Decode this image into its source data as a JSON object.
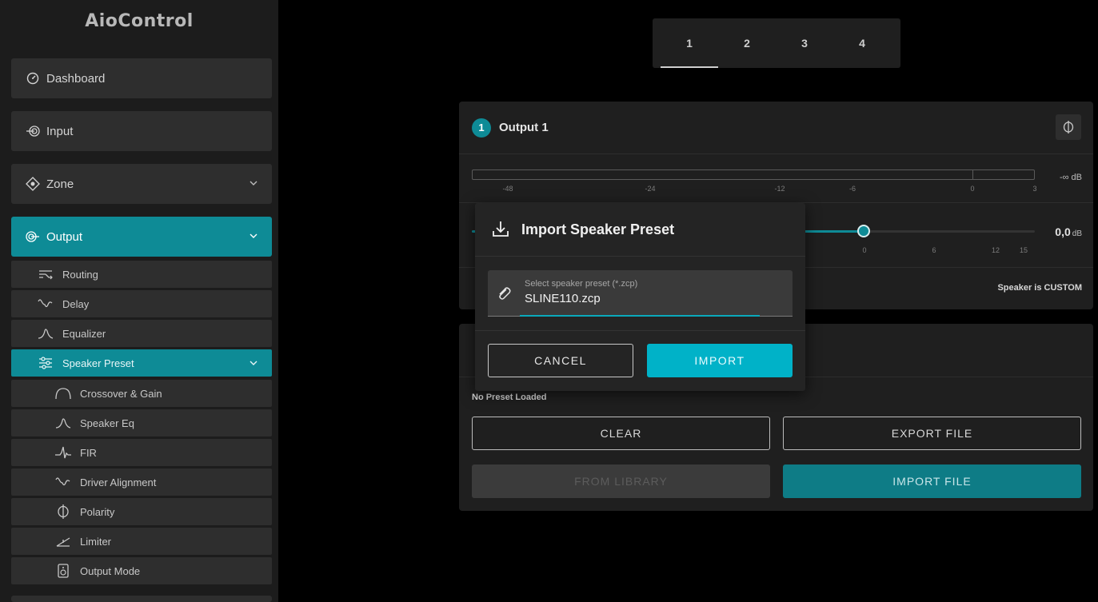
{
  "app": {
    "title": "AioControl"
  },
  "sidebar": {
    "main": [
      {
        "id": "dashboard",
        "label": "Dashboard",
        "icon": "gauge-icon"
      },
      {
        "id": "input",
        "label": "Input",
        "icon": "input-icon"
      },
      {
        "id": "zone",
        "label": "Zone",
        "icon": "zone-icon"
      },
      {
        "id": "output",
        "label": "Output",
        "icon": "output-icon"
      }
    ],
    "output_sub": [
      {
        "label": "Routing",
        "icon": "routing-icon"
      },
      {
        "label": "Delay",
        "icon": "delay-icon"
      },
      {
        "label": "Equalizer",
        "icon": "equalizer-icon"
      },
      {
        "label": "Speaker Preset",
        "icon": "sliders-icon"
      }
    ],
    "preset_sub": [
      {
        "label": "Crossover & Gain",
        "icon": "crossover-icon"
      },
      {
        "label": "Speaker Eq",
        "icon": "speaker-eq-icon"
      },
      {
        "label": "FIR",
        "icon": "fir-icon"
      },
      {
        "label": "Driver Alignment",
        "icon": "alignment-icon"
      },
      {
        "label": "Polarity",
        "icon": "polarity-icon"
      },
      {
        "label": "Limiter",
        "icon": "limiter-icon"
      },
      {
        "label": "Output Mode",
        "icon": "output-mode-icon"
      }
    ]
  },
  "tabs": [
    "1",
    "2",
    "3",
    "4"
  ],
  "active_tab": "1",
  "output_card": {
    "badge": "1",
    "title": "Output 1",
    "meter": {
      "labels": [
        "-48",
        "-24",
        "-12",
        "-6",
        "0",
        "3"
      ],
      "readout": "-∞ dB"
    },
    "fader": {
      "labels": [
        "0",
        "6",
        "12",
        "15"
      ],
      "value": "0,0",
      "unit": "dB"
    },
    "speaker_status": "Speaker is CUSTOM"
  },
  "preset_card": {
    "status": "No Preset Loaded",
    "buttons": {
      "clear": "CLEAR",
      "export": "EXPORT FILE",
      "library": "FROM LIBRARY",
      "import": "IMPORT FILE"
    }
  },
  "modal": {
    "title": "Import Speaker Preset",
    "field_label": "Select speaker preset (*.zcp)",
    "field_value": "SLINE110.zcp",
    "cancel": "CANCEL",
    "import": "IMPORT"
  },
  "colors": {
    "accent": "#0e8b96",
    "accent_bright": "#00b2c8",
    "panel": "#1f1f1f",
    "sidebar": "#1c1c1c"
  }
}
